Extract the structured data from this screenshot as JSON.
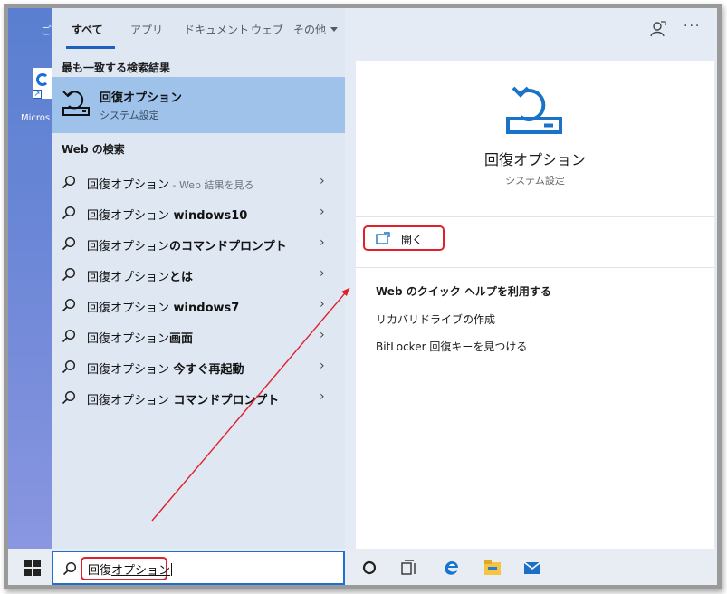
{
  "tabs": {
    "items": [
      "すべて",
      "アプリ",
      "ドキュメント",
      "ウェブ",
      "その他"
    ]
  },
  "desktop": {
    "icon_label": "Micros"
  },
  "left": {
    "best_match_header": "最も一致する検索結果",
    "best_match": {
      "title": "回復オプション",
      "subtitle": "システム設定",
      "icon": "recovery-icon"
    },
    "web_header": "Web の検索",
    "web_results": [
      {
        "prefix": "回復オプション",
        "suffix": " - Web 結果を見る"
      },
      {
        "prefix": "回復オプション",
        "suffix": " windows10"
      },
      {
        "prefix": "回復オプション",
        "suffix": "のコマンドプロンプト"
      },
      {
        "prefix": "回復オプション",
        "suffix": "とは"
      },
      {
        "prefix": "回復オプション",
        "suffix": " windows7"
      },
      {
        "prefix": "回復オプション",
        "suffix": "画面"
      },
      {
        "prefix": "回復オプション",
        "suffix": " 今すぐ再起動"
      },
      {
        "prefix": "回復オプション",
        "suffix": " コマンドプロンプト"
      }
    ]
  },
  "right": {
    "title": "回復オプション",
    "subtitle": "システム設定",
    "open_label": "開く",
    "help_title": "Web のクイック ヘルプを利用する",
    "help_links": [
      "リカバリドライブの作成",
      "BitLocker 回復キーを見つける"
    ],
    "more_label": "···"
  },
  "taskbar": {
    "search_value_a": "回復",
    "search_value_b": "オプション"
  },
  "colors": {
    "accent": "#1f5fbf",
    "highlight": "#9ec2ea",
    "annotation": "#e0202a",
    "recovery_icon": "#1a73c8"
  }
}
